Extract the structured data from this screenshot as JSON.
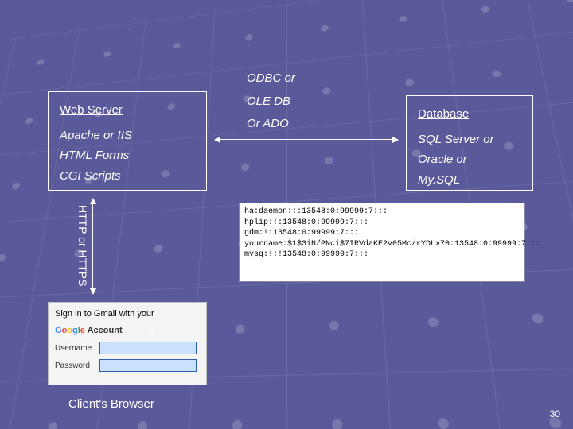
{
  "webserver": {
    "title": "Web Server",
    "l1": "Apache or IIS",
    "l2": "HTML Forms",
    "l3": "CGI Scripts"
  },
  "db": {
    "title": "Database",
    "l1": "SQL Server or",
    "l2": "Oracle or",
    "l3": "My.SQL"
  },
  "middle": {
    "l1": "ODBC or",
    "l2": "OLE DB",
    "l3": "Or ADO"
  },
  "vlabel": "HTTP or HTTPS",
  "login": {
    "title_prefix": "Sign in to Gmail with your",
    "logo_word": "Google",
    "account_word": " Account",
    "username_label": "Username",
    "password_label": "Password",
    "username_value": "",
    "password_value": ""
  },
  "client_label": "Client's Browser",
  "code_block": "ha:daemon:::13548:0:99999:7:::\nhplip:!:13548:0:99999:7:::\ngdm:!:13548:0:99999:7:::\nyourname:$1$3iN/PNci$7IRVdaKE2v05Mc/rYDLx70:13548:0:99999:7:::\nmysq:!:!13548:0:99999:7:::",
  "page_number": "30"
}
